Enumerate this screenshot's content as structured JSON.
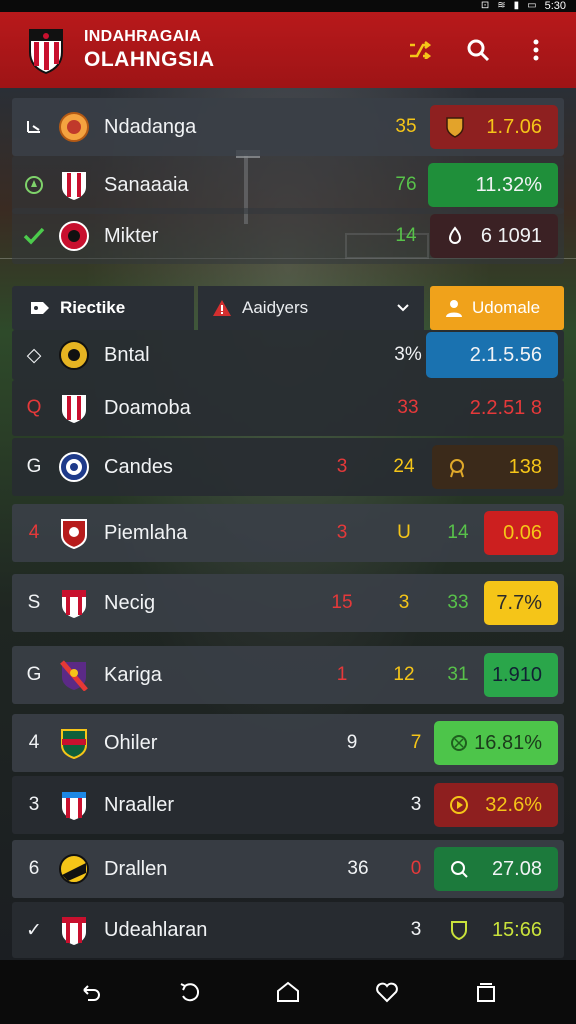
{
  "status": {
    "time": "5:30"
  },
  "header": {
    "title_line1": "INDAHRAGAIA",
    "title_line2": "OLAHNGSIA"
  },
  "top_rows": [
    {
      "lead_icon": "cursor-icon",
      "name": "Ndadanga",
      "num": "35",
      "value": "1.7.06"
    },
    {
      "lead_icon": "compass-icon",
      "name": "Sanaaaia",
      "num": "76",
      "value": "11.32%"
    },
    {
      "lead_icon": "check-icon",
      "name": "Mikter",
      "num": "14",
      "value": "6 1091"
    }
  ],
  "filter": {
    "tab_label": "Riectike",
    "select_value": "Aaidyers",
    "button_label": "Udomale"
  },
  "rows": [
    {
      "lead": "◇",
      "name": "Bntal",
      "c1": "",
      "c2": "",
      "c3": "3%",
      "value": "2.1.5.56"
    },
    {
      "lead": "Q",
      "name": "Doamoba",
      "c1": "",
      "c2": "",
      "c3": "33",
      "value": "2.2.51 8"
    },
    {
      "lead": "G",
      "name": "Candes",
      "c1": "3",
      "c2": "24",
      "c3": "",
      "value": "138"
    },
    {
      "lead": "4",
      "name": "Piemlaha",
      "c1": "3",
      "c2": "U",
      "c3": "14",
      "value": "0.06"
    },
    {
      "lead": "S",
      "name": "Necig",
      "c1": "15",
      "c2": "3",
      "c3": "33",
      "value": "7.7%"
    },
    {
      "lead": "G",
      "name": "Kariga",
      "c1": "1",
      "c2": "12",
      "c3": "31",
      "value": "1.910"
    },
    {
      "lead": "4",
      "name": "Ohiler",
      "c1": "9",
      "c2": "7",
      "c3": "",
      "value": "16.81%"
    },
    {
      "lead": "3",
      "name": "Nraaller",
      "c1": "",
      "c2": "3",
      "c3": "",
      "value": "32.6%"
    },
    {
      "lead": "6",
      "name": "Drallen",
      "c1": "36",
      "c2": "0",
      "c3": "",
      "value": "27.08"
    },
    {
      "lead": "✓",
      "name": "Udeahlaran",
      "c1": "",
      "c2": "3",
      "c3": "",
      "value": "15:66"
    }
  ]
}
